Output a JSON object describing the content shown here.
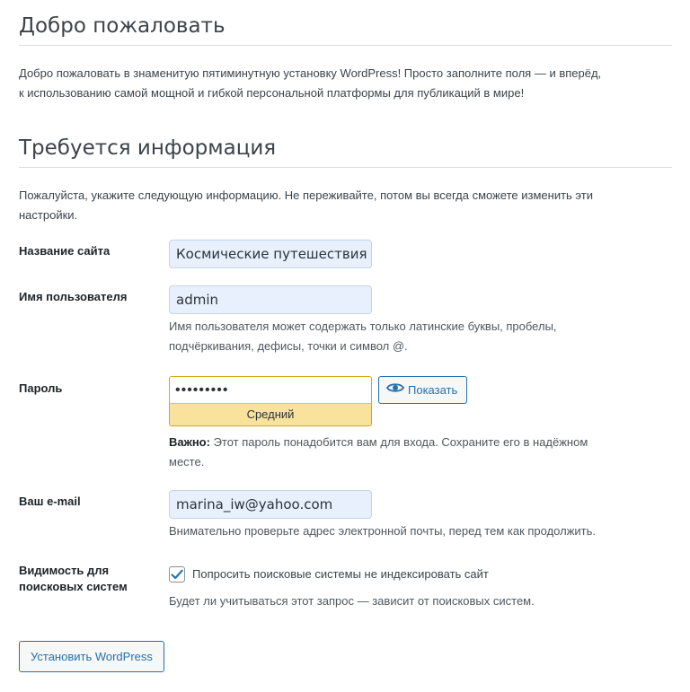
{
  "welcome": {
    "title": "Добро пожаловать",
    "text_line1": "Добро пожаловать в знаменитую пятиминутную установку WordPress! Просто заполните поля — и вперёд,",
    "text_line2": "к использованию самой мощной и гибкой персональной платформы для публикаций в мире!"
  },
  "info": {
    "title": "Требуется информация",
    "text_line1": "Пожалуйста, укажите следующую информацию. Не переживайте, потом вы всегда сможете изменить эти",
    "text_line2": "настройки."
  },
  "form": {
    "site_title": {
      "label": "Название сайта",
      "value": "Космические путешествия"
    },
    "username": {
      "label": "Имя пользователя",
      "value": "admin",
      "hint_line1": "Имя пользователя может содержать только латинские буквы, пробелы,",
      "hint_line2": "подчёркивания, дефисы, точки и символ @."
    },
    "password": {
      "label": "Пароль",
      "value": "•••••••••",
      "strength": "Средний",
      "strength_color": "#f9e29c",
      "show_label": "Показать",
      "show_icon": "eye-icon",
      "note_bold": "Важно:",
      "note_line1": " Этот пароль понадобится вам для входа. Сохраните его в надёжном",
      "note_line2": "месте."
    },
    "email": {
      "label": "Ваш e-mail",
      "value": "marina_iw@yahoo.com",
      "hint": "Внимательно проверьте адрес электронной почты, перед тем как продолжить."
    },
    "visibility": {
      "label_line1": "Видимость для",
      "label_line2": "поисковых систем",
      "checked": true,
      "checkbox_label": "Попросить поисковые системы не индексировать сайт",
      "hint": "Будет ли учитываться этот запрос — зависит от поисковых систем."
    },
    "submit_label": "Установить WordPress"
  },
  "colors": {
    "accent": "#2271b1",
    "autofill_bg": "#e8f0fe",
    "strength_border": "#dba617"
  }
}
